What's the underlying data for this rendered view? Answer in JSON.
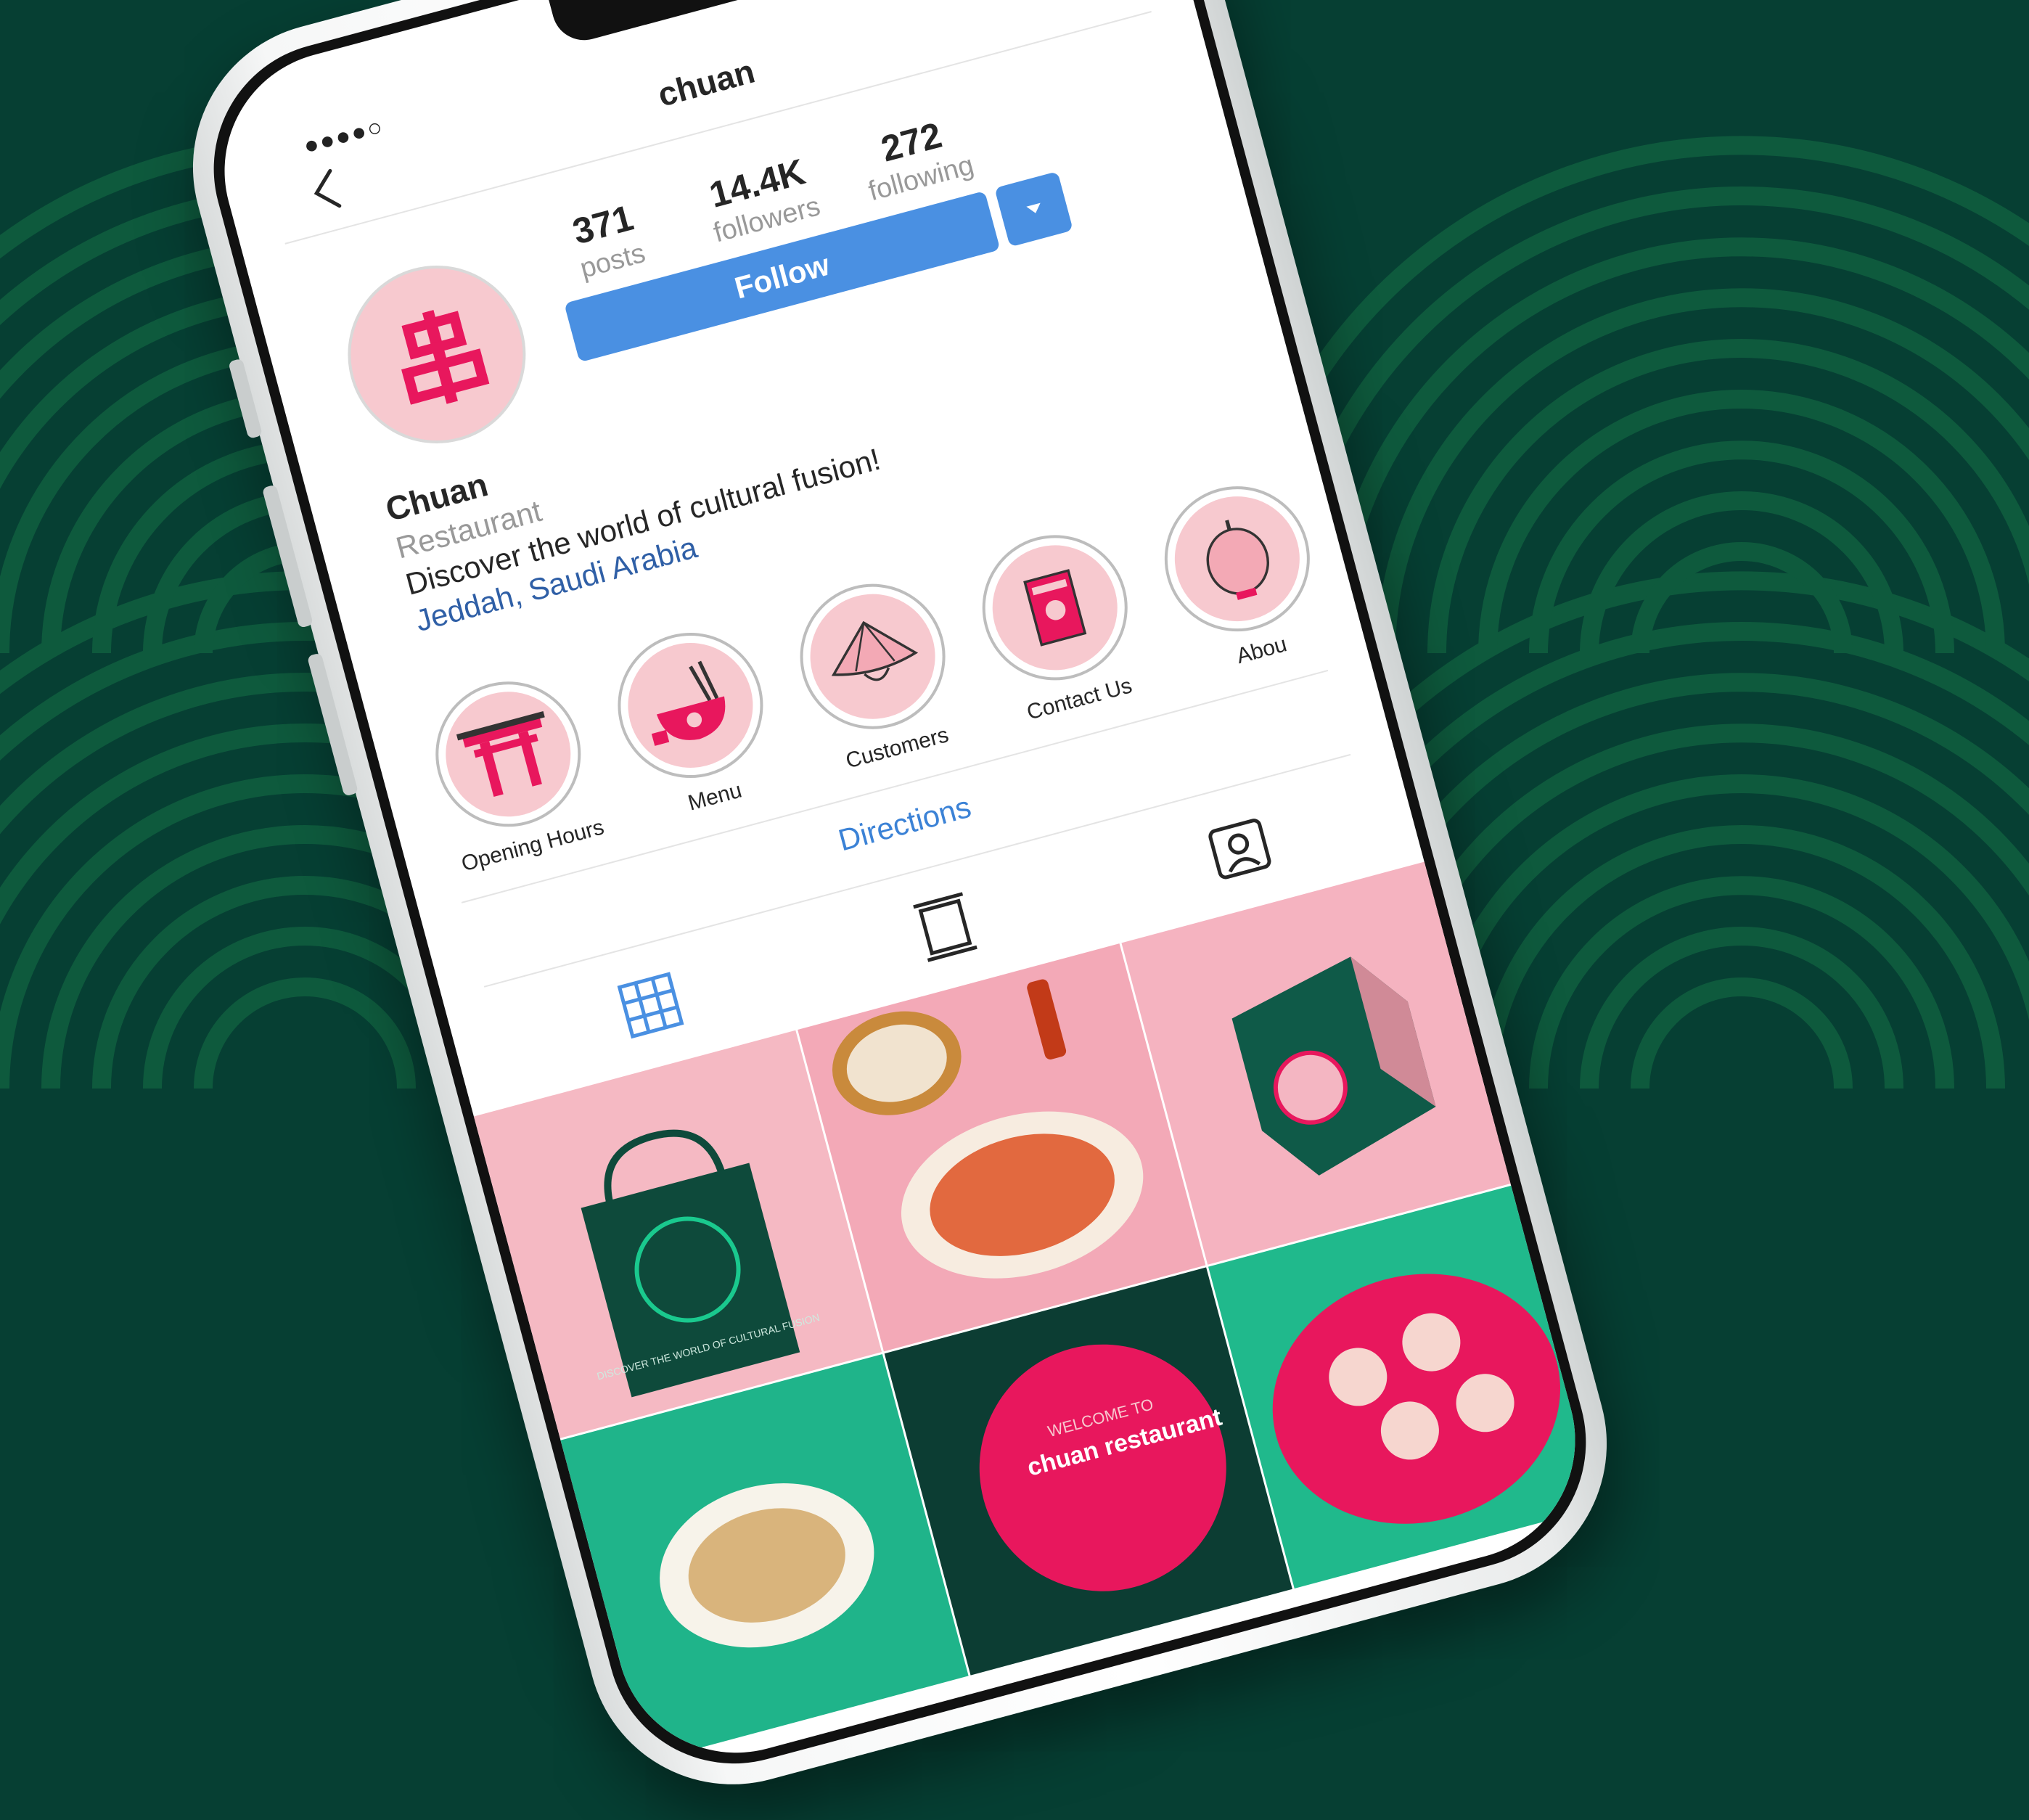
{
  "status": {
    "signal": "●●●●○",
    "more": "•••"
  },
  "header": {
    "username": "chuan"
  },
  "stats": [
    {
      "value": "371",
      "label": "posts"
    },
    {
      "value": "14.4K",
      "label": "followers"
    },
    {
      "value": "272",
      "label": "following"
    }
  ],
  "follow_label": "Follow",
  "bio": {
    "name": "Chuan",
    "category": "Restaurant",
    "text": "Discover the world of cultural fusion!",
    "location": "Jeddah, Saudi Arabia"
  },
  "highlights": [
    {
      "label": "Opening Hours",
      "icon": "torii-gate-icon"
    },
    {
      "label": "Menu",
      "icon": "noodle-bowl-icon"
    },
    {
      "label": "Customers",
      "icon": "conical-hat-icon"
    },
    {
      "label": "Contact Us",
      "icon": "tea-box-icon"
    },
    {
      "label": "Abou",
      "icon": "lantern-icon"
    }
  ],
  "directions_label": "Directions",
  "tabs": [
    {
      "name": "grid-view-icon",
      "active": true
    },
    {
      "name": "feed-view-icon",
      "active": false
    },
    {
      "name": "tagged-view-icon",
      "active": false
    }
  ],
  "grid_tile_text": {
    "bag": "DISCOVER THE WORLD OF CULTURAL FUSION",
    "poster_small": "WELCOME TO",
    "poster_big": "chuan restaurant"
  },
  "colors": {
    "background": "#063f33",
    "pattern": "#0e5a3d",
    "brand_pink": "#e8175d",
    "follow_blue": "#4a90e2",
    "avatar_bg": "#f7c9cf"
  }
}
